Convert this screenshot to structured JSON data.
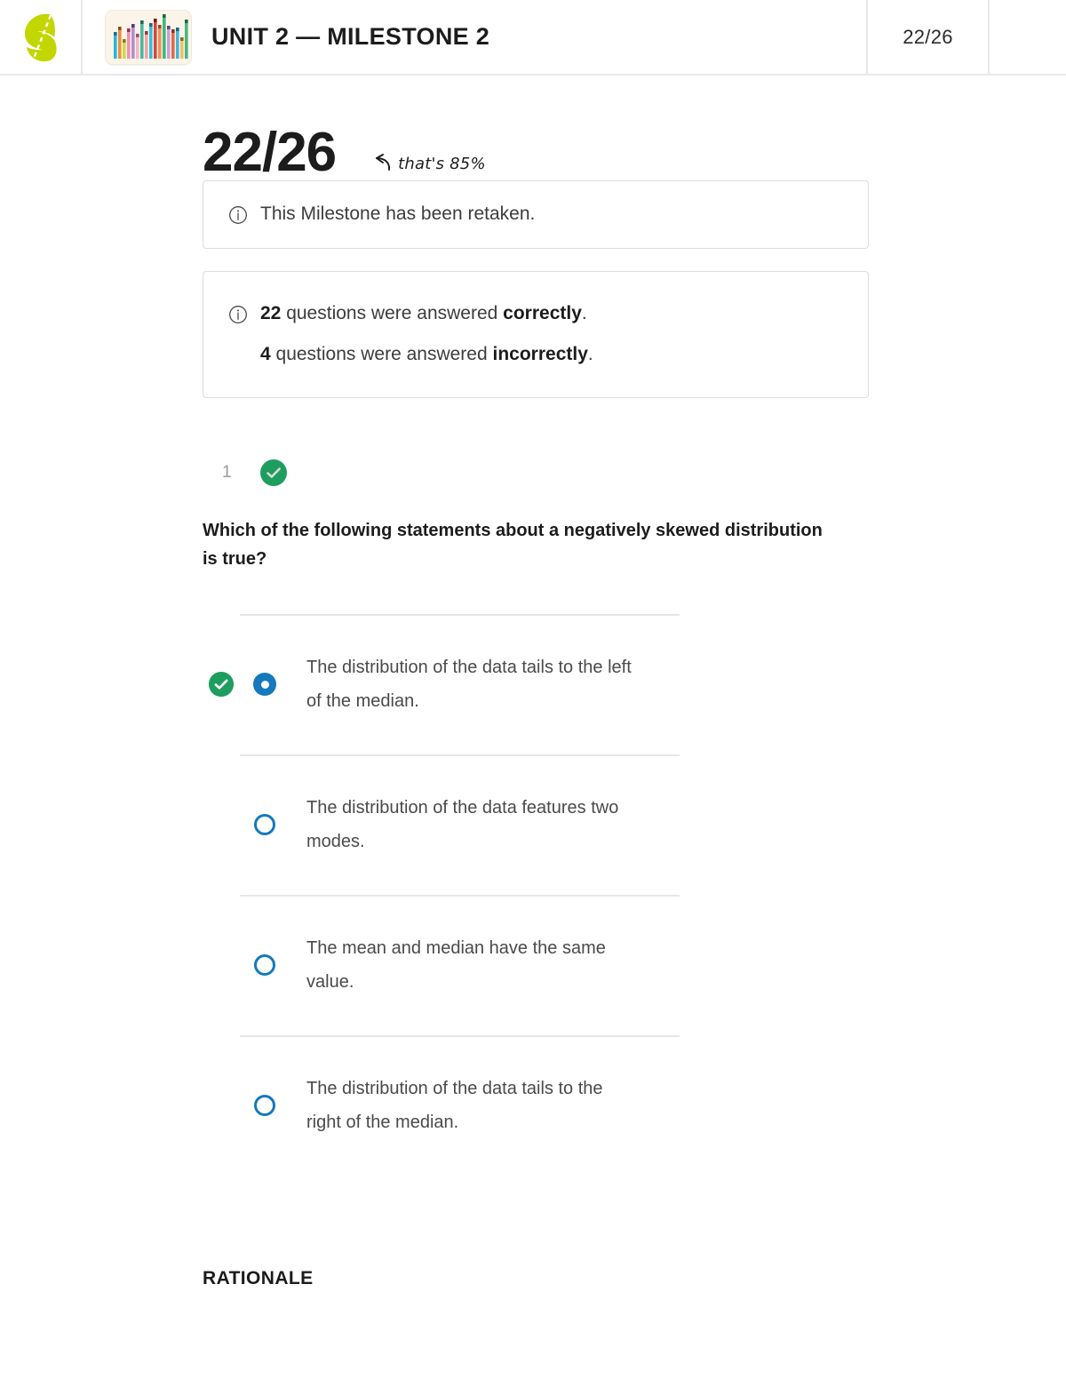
{
  "header": {
    "logo_name": "sophia-logo",
    "thumbnail_name": "course-thumbnail",
    "title": "UNIT 2 — MILESTONE 2",
    "score": "22/26"
  },
  "result": {
    "big_score": "22/26",
    "annotation": "that's 85%",
    "annotation_arrow": "curved-left-arrow-icon"
  },
  "notices": [
    {
      "icon": "info-icon",
      "text": "This Milestone has been retaken."
    },
    {
      "icon": "info-icon",
      "line1_count": "22",
      "line1_mid": " questions were answered ",
      "line1_bold": "correctly",
      "line1_end": ".",
      "line2_count": "4",
      "line2_mid": " questions were answered ",
      "line2_bold": "incorrectly",
      "line2_end": "."
    }
  ],
  "question": {
    "number": "1",
    "status_icon": "check-circle-icon",
    "status": "correct",
    "text": "Which of the following statements about a negatively skewed distribution is true?",
    "options": [
      {
        "text": "The distribution of the data tails to the left of the median.",
        "selected": true,
        "correct": true
      },
      {
        "text": "The distribution of the data features two modes.",
        "selected": false,
        "correct": false
      },
      {
        "text": "The mean and median have the same value.",
        "selected": false,
        "correct": false
      },
      {
        "text": "The distribution of the data tails to the right of the median.",
        "selected": false,
        "correct": false
      }
    ]
  },
  "rationale_heading": "RATIONALE",
  "colors": {
    "brand_green": "#c3d600",
    "correct_green": "#1e9e5e",
    "radio_blue": "#1479bd",
    "border_gray": "#dcdce2",
    "divider_gray": "#e6e6ea",
    "muted_text": "#9a9a9a"
  }
}
